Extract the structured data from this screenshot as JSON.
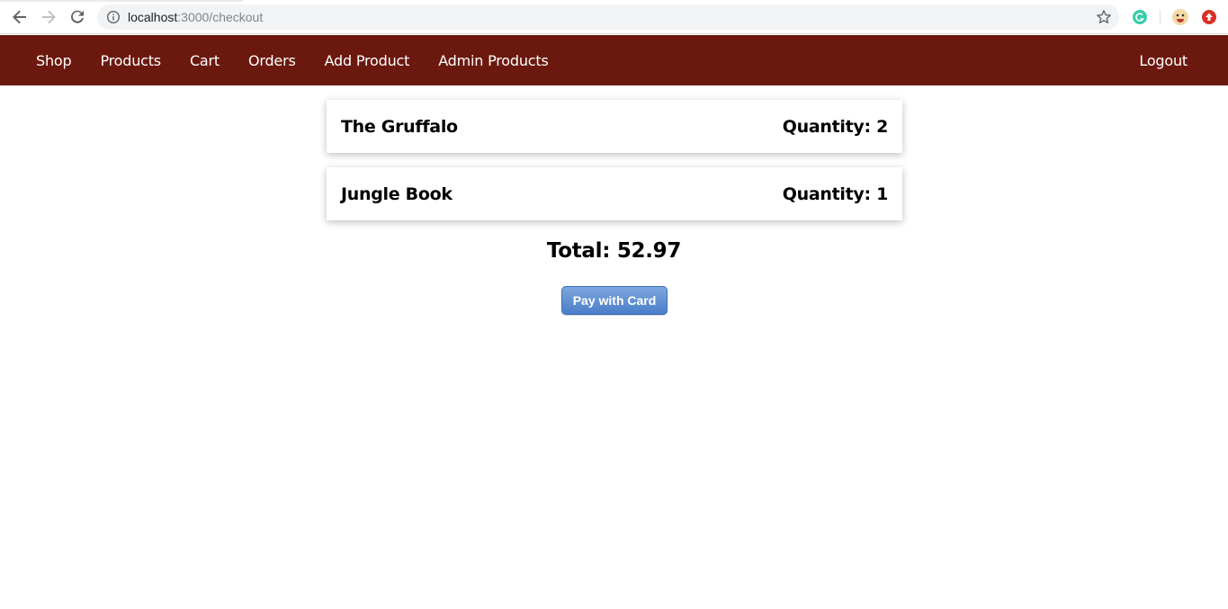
{
  "browser": {
    "url_host": "localhost",
    "url_rest": ":3000/checkout"
  },
  "nav": {
    "items": [
      {
        "label": "Shop"
      },
      {
        "label": "Products"
      },
      {
        "label": "Cart"
      },
      {
        "label": "Orders"
      },
      {
        "label": "Add Product"
      },
      {
        "label": "Admin Products"
      }
    ],
    "logout_label": "Logout"
  },
  "cart": {
    "items": [
      {
        "title": "The Gruffalo",
        "quantity": "Quantity: 2"
      },
      {
        "title": "Jungle Book",
        "quantity": "Quantity: 1"
      }
    ],
    "total": "Total: 52.97"
  },
  "pay_button": {
    "label": "Pay with Card"
  },
  "colors": {
    "navbar": "#6b190f",
    "pay_button": "#5b8bd2"
  }
}
